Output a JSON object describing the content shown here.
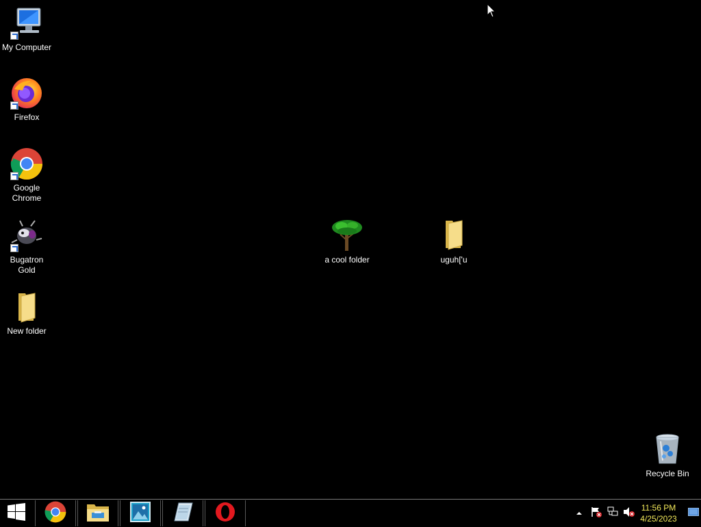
{
  "desktop": {
    "icons": [
      {
        "label": "My Computer",
        "icon": "my-computer-icon",
        "shortcut": true
      },
      {
        "label": "Firefox",
        "icon": "firefox-icon",
        "shortcut": true
      },
      {
        "label": "Google Chrome",
        "icon": "chrome-icon",
        "shortcut": true
      },
      {
        "label": "Bugatron Gold",
        "icon": "bugatron-icon",
        "shortcut": true
      },
      {
        "label": "New folder",
        "icon": "folder-icon",
        "shortcut": false
      },
      {
        "label": "a cool folder",
        "icon": "tree-folder-icon",
        "shortcut": false
      },
      {
        "label": "uguh['u",
        "icon": "folder-icon",
        "shortcut": false
      },
      {
        "label": "Recycle Bin",
        "icon": "recycle-bin-icon",
        "shortcut": false
      }
    ]
  },
  "taskbar": {
    "start": {
      "icon": "windows-logo-icon"
    },
    "pinned": [
      {
        "icon": "chrome-icon"
      },
      {
        "icon": "file-explorer-icon"
      },
      {
        "icon": "photo-viewer-icon"
      },
      {
        "icon": "notepad-icon"
      },
      {
        "icon": "opera-icon"
      }
    ],
    "tray": {
      "icons": [
        "show-hidden-icons-chevron",
        "action-center-flag-icon",
        "network-icon",
        "volume-muted-icon"
      ],
      "time": "11:56 PM",
      "date": "4/25/2023"
    }
  }
}
